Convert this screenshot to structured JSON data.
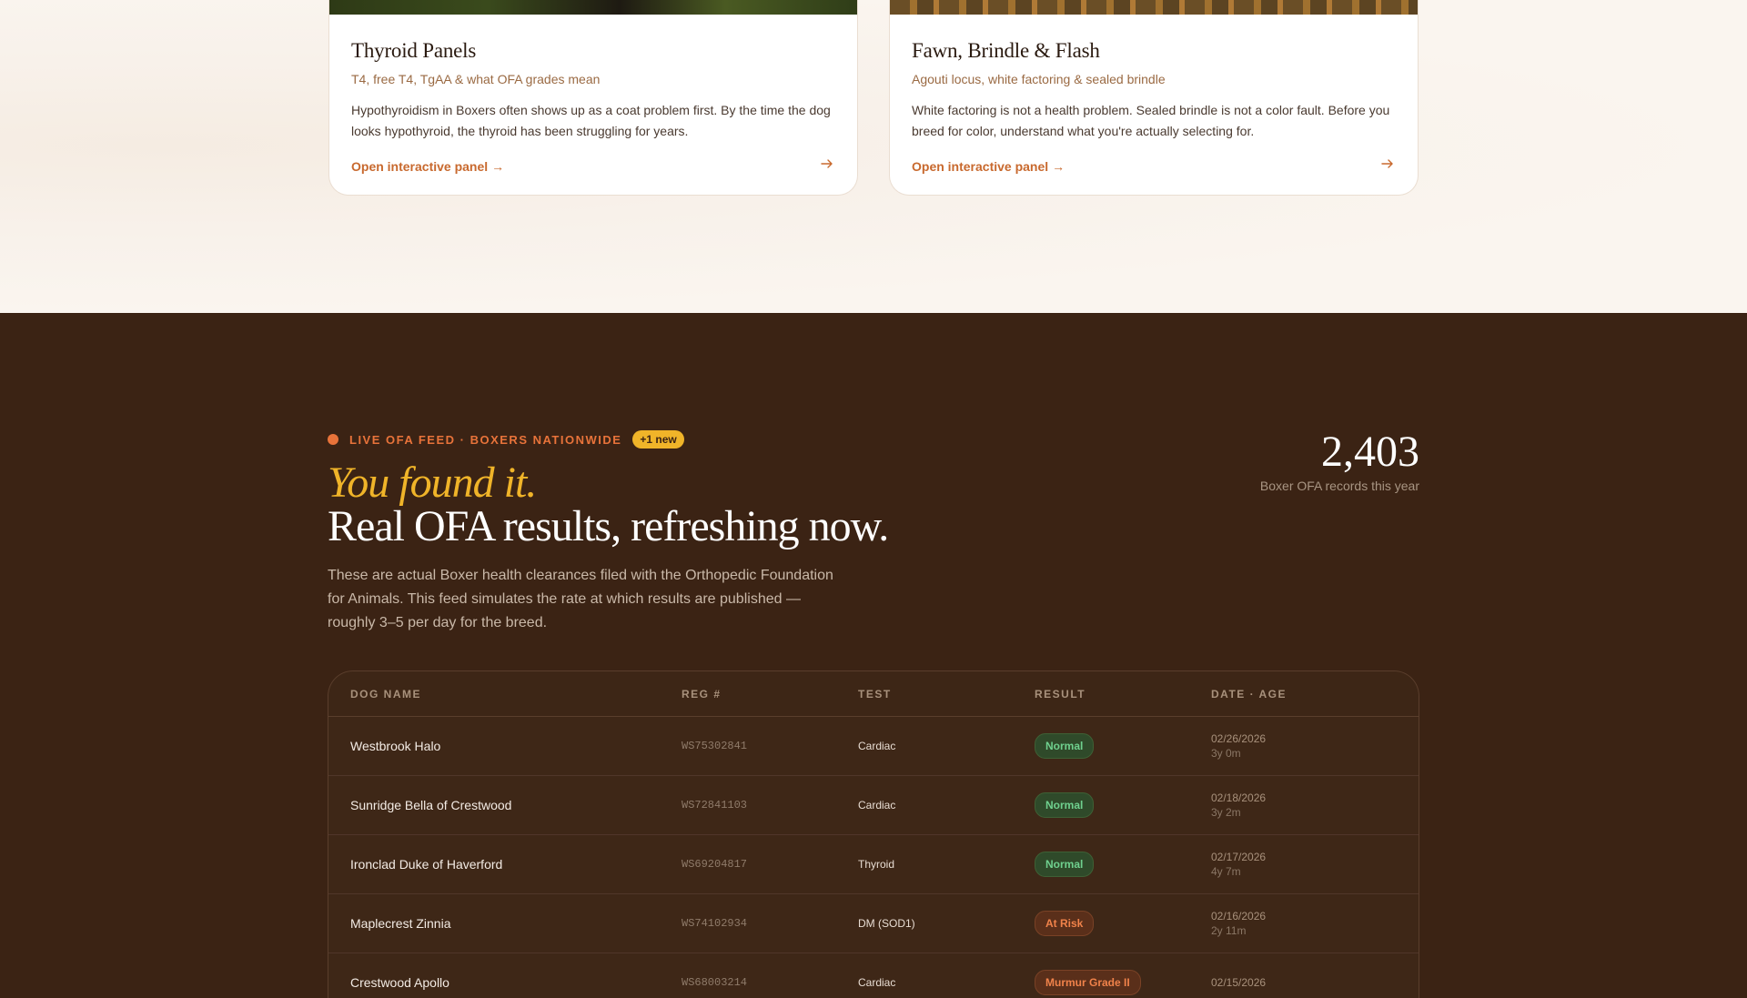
{
  "cards": [
    {
      "title": "Thyroid Panels",
      "subtitle": "T4, free T4, TgAA & what OFA grades mean",
      "description": "Hypothyroidism in Boxers often shows up as a coat problem first. By the time the dog looks hypothyroid, the thyroid has been struggling for years.",
      "link_label": "Open interactive panel",
      "link_arrow": "→",
      "icon": "arrow-right-icon"
    },
    {
      "title": "Fawn, Brindle & Flash",
      "subtitle": "Agouti locus, white factoring & sealed brindle",
      "description": "White factoring is not a health problem. Sealed brindle is not a color fault. Before you breed for color, understand what you're actually selecting for.",
      "link_label": "Open interactive panel",
      "link_arrow": "→",
      "icon": "arrow-right-icon"
    }
  ],
  "feed": {
    "live_label": "LIVE OFA FEED · BOXERS NATIONWIDE",
    "new_badge": "+1 new",
    "headline_italic": "You found it.",
    "headline_main": "Real OFA results, refreshing now.",
    "intro": "These are actual Boxer health clearances filed with the Orthopedic Foundation for Animals. This feed simulates the rate at which results are published — roughly 3–5 per day for the breed.",
    "stat_number": "2,403",
    "stat_label": "Boxer OFA records this year",
    "colors": {
      "accent_orange": "#e8733a",
      "accent_gold": "#f0b429",
      "background": "#3b2314"
    }
  },
  "table": {
    "headers": [
      "DOG NAME",
      "REG #",
      "TEST",
      "RESULT",
      "DATE · AGE"
    ],
    "rows": [
      {
        "name": "Westbrook Halo",
        "reg": "WS75302841",
        "test": "Cardiac",
        "result": "Normal",
        "result_type": "normal",
        "date": "02/26/2026",
        "age": "3y 0m"
      },
      {
        "name": "Sunridge Bella of Crestwood",
        "reg": "WS72841103",
        "test": "Cardiac",
        "result": "Normal",
        "result_type": "normal",
        "date": "02/18/2026",
        "age": "3y 2m"
      },
      {
        "name": "Ironclad Duke of Haverford",
        "reg": "WS69204817",
        "test": "Thyroid",
        "result": "Normal",
        "result_type": "normal",
        "date": "02/17/2026",
        "age": "4y 7m"
      },
      {
        "name": "Maplecrest Zinnia",
        "reg": "WS74102934",
        "test": "DM (SOD1)",
        "result": "At Risk",
        "result_type": "risk",
        "date": "02/16/2026",
        "age": "2y 11m"
      },
      {
        "name": "Crestwood Apollo",
        "reg": "WS68003214",
        "test": "Cardiac",
        "result": "Murmur Grade II",
        "result_type": "murmur",
        "date": "02/15/2026",
        "age": ""
      }
    ]
  }
}
